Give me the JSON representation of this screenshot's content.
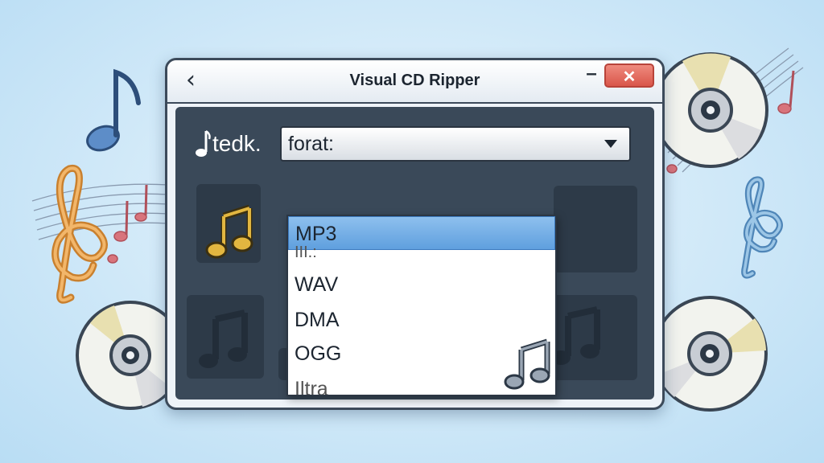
{
  "window": {
    "title": "Visual CD Ripper",
    "back_glyph": "‹",
    "minimize_glyph": "–",
    "close_glyph": "✕"
  },
  "app_logo_text": "tedk.",
  "format_select": {
    "value": "forat:"
  },
  "format_options": [
    {
      "label": "MP3",
      "selected": true
    },
    {
      "label": "III.:",
      "selected": false
    },
    {
      "label": "WAV",
      "selected": false
    },
    {
      "label": "DMA",
      "selected": false
    },
    {
      "label": "OGG",
      "selected": false
    },
    {
      "label": "Iltra",
      "selected": false
    }
  ],
  "icons": [
    "back-icon",
    "minimize-icon",
    "close-icon",
    "music-note-icon",
    "chevron-down-icon",
    "cd-disc-icon",
    "treble-clef-icon"
  ],
  "colors": {
    "background": "#cfe8f8",
    "window_frame": "#3c4a5a",
    "content_bg": "#3a4959",
    "close_button": "#d9564a",
    "selected_option": "#6aa8e2"
  }
}
